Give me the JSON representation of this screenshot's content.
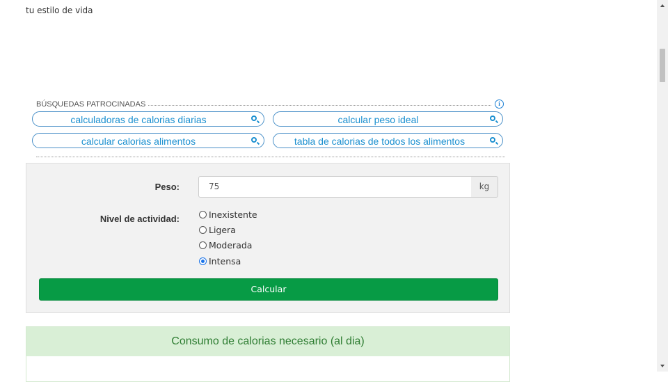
{
  "intro_text": "tu estilo de vida",
  "sponsored": {
    "header": "BÚSQUEDAS PATROCINADAS",
    "info_icon": "ⓘ",
    "pills": [
      {
        "label": "calculadoras de calorias diarias",
        "icon": "search-icon"
      },
      {
        "label": "calcular peso ideal",
        "icon": "search-icon"
      },
      {
        "label": "calcular calorias alimentos",
        "icon": "search-icon"
      },
      {
        "label": "tabla de calorias de todos los alimentos",
        "icon": "search-icon"
      }
    ]
  },
  "form": {
    "peso_label": "Peso:",
    "peso_value": "75",
    "peso_unit": "kg",
    "actividad_label": "Nivel de actividad:",
    "options": [
      {
        "label": "Inexistente",
        "checked": false
      },
      {
        "label": "Ligera",
        "checked": false
      },
      {
        "label": "Moderada",
        "checked": false
      },
      {
        "label": "Intensa",
        "checked": true
      }
    ],
    "submit_label": "Calcular"
  },
  "result": {
    "title": "Consumo de calorias necesario (al dia)"
  },
  "colors": {
    "accent_green": "#079b45",
    "link_blue": "#1a8fd0",
    "result_bg": "#d9efd6"
  }
}
